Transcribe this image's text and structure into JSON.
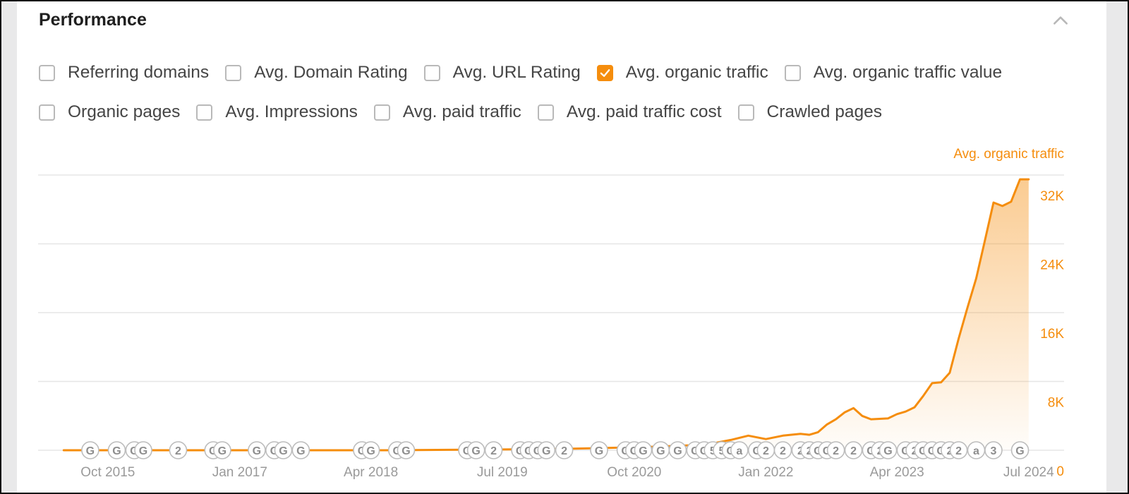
{
  "panel": {
    "title": "Performance",
    "collapse_icon": "chevron-up-icon"
  },
  "filters": [
    [
      {
        "label": "Referring domains",
        "checked": false
      },
      {
        "label": "Avg. Domain Rating",
        "checked": false
      },
      {
        "label": "Avg. URL Rating",
        "checked": false
      },
      {
        "label": "Avg. organic traffic",
        "checked": true
      },
      {
        "label": "Avg. organic traffic value",
        "checked": false
      }
    ],
    [
      {
        "label": "Organic pages",
        "checked": false
      },
      {
        "label": "Avg. Impressions",
        "checked": false
      },
      {
        "label": "Avg. paid traffic",
        "checked": false
      },
      {
        "label": "Avg. paid traffic cost",
        "checked": false
      },
      {
        "label": "Crawled pages",
        "checked": false
      }
    ]
  ],
  "colors": {
    "accent": "#f58d0d",
    "grid": "#e6e6e6",
    "axis_text": "#9a9a9a",
    "marker_border": "#bdbdbd"
  },
  "chart_data": {
    "type": "area",
    "series": [
      {
        "name": "Avg. organic traffic",
        "color": "#f58d0d",
        "points": [
          [
            "2015-05-01",
            0
          ],
          [
            "2016-06-01",
            0
          ],
          [
            "2017-06-01",
            0
          ],
          [
            "2018-06-01",
            0
          ],
          [
            "2019-01-01",
            50
          ],
          [
            "2019-06-01",
            80
          ],
          [
            "2020-01-01",
            150
          ],
          [
            "2020-06-01",
            250
          ],
          [
            "2020-12-01",
            400
          ],
          [
            "2021-05-01",
            600
          ],
          [
            "2021-07-01",
            800
          ],
          [
            "2021-09-01",
            1200
          ],
          [
            "2021-11-01",
            1700
          ],
          [
            "2022-01-01",
            1300
          ],
          [
            "2022-03-01",
            1700
          ],
          [
            "2022-05-01",
            1900
          ],
          [
            "2022-06-01",
            1800
          ],
          [
            "2022-07-01",
            2100
          ],
          [
            "2022-08-01",
            3000
          ],
          [
            "2022-09-01",
            3600
          ],
          [
            "2022-10-01",
            4400
          ],
          [
            "2022-11-01",
            4900
          ],
          [
            "2022-12-01",
            4000
          ],
          [
            "2023-01-01",
            3600
          ],
          [
            "2023-03-01",
            3700
          ],
          [
            "2023-04-01",
            4200
          ],
          [
            "2023-05-01",
            4500
          ],
          [
            "2023-06-01",
            5000
          ],
          [
            "2023-07-01",
            6300
          ],
          [
            "2023-08-01",
            7800
          ],
          [
            "2023-09-01",
            7900
          ],
          [
            "2023-10-01",
            9000
          ],
          [
            "2023-11-01",
            13000
          ],
          [
            "2023-12-01",
            16500
          ],
          [
            "2024-01-01",
            20000
          ],
          [
            "2024-02-01",
            24500
          ],
          [
            "2024-03-01",
            28800
          ],
          [
            "2024-04-01",
            28400
          ],
          [
            "2024-05-01",
            28900
          ],
          [
            "2024-06-01",
            31500
          ],
          [
            "2024-07-01",
            31500
          ]
        ]
      }
    ],
    "title": "",
    "legend": "Avg. organic traffic",
    "xlabel": "",
    "ylabel": "",
    "xlim": [
      "2015-02-01",
      "2024-11-01"
    ],
    "ylim": [
      0,
      32000
    ],
    "x_ticks": [
      {
        "date": "2015-10-01",
        "label": "Oct 2015"
      },
      {
        "date": "2017-01-01",
        "label": "Jan 2017"
      },
      {
        "date": "2018-04-01",
        "label": "Apr 2018"
      },
      {
        "date": "2019-07-01",
        "label": "Jul 2019"
      },
      {
        "date": "2020-10-01",
        "label": "Oct 2020"
      },
      {
        "date": "2022-01-01",
        "label": "Jan 2022"
      },
      {
        "date": "2023-04-01",
        "label": "Apr 2023"
      },
      {
        "date": "2024-07-01",
        "label": "Jul 2024"
      }
    ],
    "y_ticks": [
      {
        "value": 0,
        "label": "0"
      },
      {
        "value": 8000,
        "label": "8K"
      },
      {
        "value": 16000,
        "label": "16K"
      },
      {
        "value": 24000,
        "label": "24K"
      },
      {
        "value": 32000,
        "label": "32K"
      }
    ],
    "grid": true,
    "annotations": [
      {
        "date": "2015-08-01",
        "label": "G"
      },
      {
        "date": "2015-11-01",
        "label": "G"
      },
      {
        "date": "2016-01-01",
        "label": "G"
      },
      {
        "date": "2016-02-01",
        "label": "G"
      },
      {
        "date": "2016-06-01",
        "label": "2"
      },
      {
        "date": "2016-10-01",
        "label": "G"
      },
      {
        "date": "2016-11-01",
        "label": "G"
      },
      {
        "date": "2017-03-01",
        "label": "G"
      },
      {
        "date": "2017-05-01",
        "label": "G"
      },
      {
        "date": "2017-06-01",
        "label": "G"
      },
      {
        "date": "2017-08-01",
        "label": "G"
      },
      {
        "date": "2018-03-01",
        "label": "G"
      },
      {
        "date": "2018-04-01",
        "label": "G"
      },
      {
        "date": "2018-07-01",
        "label": "G"
      },
      {
        "date": "2018-08-01",
        "label": "G"
      },
      {
        "date": "2019-03-01",
        "label": "G"
      },
      {
        "date": "2019-04-01",
        "label": "G"
      },
      {
        "date": "2019-06-01",
        "label": "2"
      },
      {
        "date": "2019-09-01",
        "label": "G"
      },
      {
        "date": "2019-10-01",
        "label": "G"
      },
      {
        "date": "2019-11-01",
        "label": "G"
      },
      {
        "date": "2019-12-01",
        "label": "G"
      },
      {
        "date": "2020-02-01",
        "label": "2"
      },
      {
        "date": "2020-06-01",
        "label": "G"
      },
      {
        "date": "2020-09-01",
        "label": "G"
      },
      {
        "date": "2020-10-01",
        "label": "G"
      },
      {
        "date": "2020-11-01",
        "label": "G"
      },
      {
        "date": "2021-01-01",
        "label": "G"
      },
      {
        "date": "2021-03-01",
        "label": "G"
      },
      {
        "date": "2021-05-01",
        "label": "G"
      },
      {
        "date": "2021-06-01",
        "label": "G"
      },
      {
        "date": "2021-07-01",
        "label": "5"
      },
      {
        "date": "2021-08-01",
        "label": "5"
      },
      {
        "date": "2021-09-01",
        "label": "G"
      },
      {
        "date": "2021-10-01",
        "label": "a"
      },
      {
        "date": "2021-12-01",
        "label": "G"
      },
      {
        "date": "2022-01-01",
        "label": "2"
      },
      {
        "date": "2022-03-01",
        "label": "2"
      },
      {
        "date": "2022-05-01",
        "label": "2"
      },
      {
        "date": "2022-06-01",
        "label": "2"
      },
      {
        "date": "2022-07-01",
        "label": "G"
      },
      {
        "date": "2022-08-01",
        "label": "G"
      },
      {
        "date": "2022-09-01",
        "label": "2"
      },
      {
        "date": "2022-11-01",
        "label": "2"
      },
      {
        "date": "2023-01-01",
        "label": "G"
      },
      {
        "date": "2023-02-01",
        "label": "2"
      },
      {
        "date": "2023-03-01",
        "label": "G"
      },
      {
        "date": "2023-05-01",
        "label": "G"
      },
      {
        "date": "2023-06-01",
        "label": "2"
      },
      {
        "date": "2023-07-01",
        "label": "G"
      },
      {
        "date": "2023-08-01",
        "label": "G"
      },
      {
        "date": "2023-09-01",
        "label": "G"
      },
      {
        "date": "2023-10-01",
        "label": "2"
      },
      {
        "date": "2023-11-01",
        "label": "2"
      },
      {
        "date": "2024-01-01",
        "label": "a"
      },
      {
        "date": "2024-03-01",
        "label": "3"
      },
      {
        "date": "2024-06-01",
        "label": "G"
      }
    ]
  }
}
